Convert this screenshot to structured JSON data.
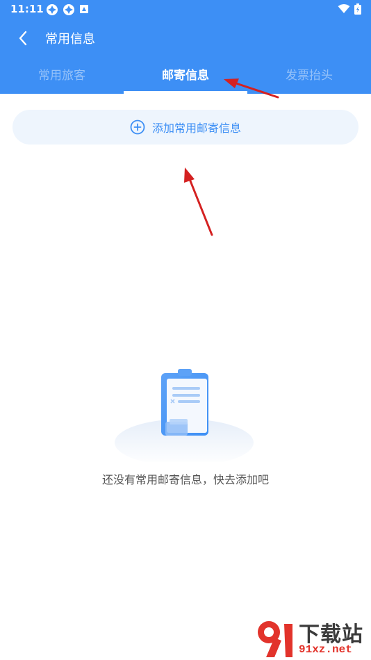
{
  "status_bar": {
    "time": "11:11",
    "left_icons": [
      "app-notification-icon",
      "app-notification-icon",
      "android-icon"
    ],
    "right_icons": [
      "wifi-icon",
      "battery-icon"
    ]
  },
  "header": {
    "title": "常用信息",
    "back_icon": "chevron-left-icon",
    "background_color": "#3d8ff5"
  },
  "tabs": [
    {
      "label": "常用旅客",
      "active": false
    },
    {
      "label": "邮寄信息",
      "active": true
    },
    {
      "label": "发票抬头",
      "active": false
    }
  ],
  "add_button": {
    "label": "添加常用邮寄信息",
    "icon": "plus-circle-icon",
    "color": "#3d8ff5"
  },
  "empty_state": {
    "icon": "clipboard-illustration",
    "message": "还没有常用邮寄信息，快去添加吧"
  },
  "watermark": {
    "line1": "下载站",
    "line2": "91xz.net"
  }
}
